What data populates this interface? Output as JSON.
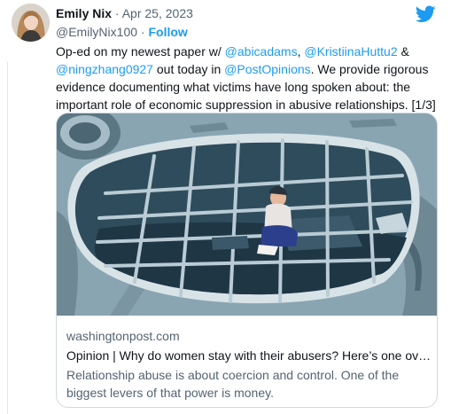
{
  "tweet": {
    "author_name": "Emily Nix",
    "separator": "·",
    "date": "Apr 25, 2023",
    "handle": "@EmilyNix100",
    "handle_separator": "·",
    "follow_label": "Follow",
    "text_segments": [
      {
        "text": "Op-ed on my newest paper w/ ",
        "type": "plain"
      },
      {
        "text": "@abicadams",
        "type": "mention"
      },
      {
        "text": ", ",
        "type": "plain"
      },
      {
        "text": "@KristiinaHuttu2",
        "type": "mention"
      },
      {
        "text": " & ",
        "type": "plain"
      },
      {
        "text": "@ningzhang0927",
        "type": "mention"
      },
      {
        "text": " out today in ",
        "type": "plain"
      },
      {
        "text": "@PostOpinions",
        "type": "mention"
      },
      {
        "text": ". We provide rigorous evidence documenting what victims have long spoken about: the important role of economic suppression in abusive relationships. [1/3]",
        "type": "plain"
      }
    ]
  },
  "card": {
    "domain": "washingtonpost.com",
    "title": "Opinion | Why do women stay with their abusers? Here’s one ov…",
    "description": "Relationship abuse is about coercion and control. One of the biggest levers of that power is money.",
    "image_icon": "wallet-cage-illustration"
  },
  "icons": {
    "twitter_logo": "twitter-bird-icon",
    "avatar": "user-avatar"
  },
  "colors": {
    "accent": "#1d9bf0",
    "text_primary": "#0f1419",
    "text_secondary": "#536471",
    "border": "#cfd9de"
  }
}
